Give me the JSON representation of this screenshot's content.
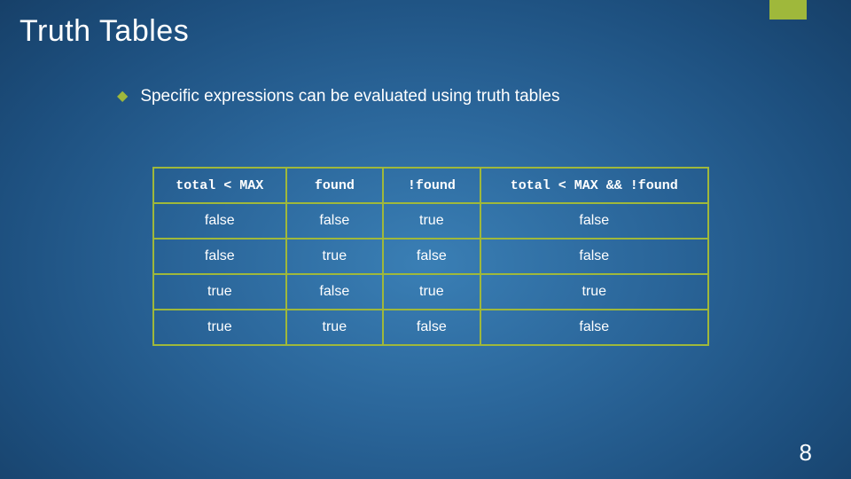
{
  "accent_color": "#9fb83b",
  "title": "Truth Tables",
  "bullet": "Specific expressions can be evaluated using truth tables",
  "table": {
    "headers": [
      "total < MAX",
      "found",
      "!found",
      "total < MAX && !found"
    ],
    "rows": [
      [
        "false",
        "false",
        "true",
        "false"
      ],
      [
        "false",
        "true",
        "false",
        "false"
      ],
      [
        "true",
        "false",
        "true",
        "true"
      ],
      [
        "true",
        "true",
        "false",
        "false"
      ]
    ]
  },
  "page_number": "8"
}
